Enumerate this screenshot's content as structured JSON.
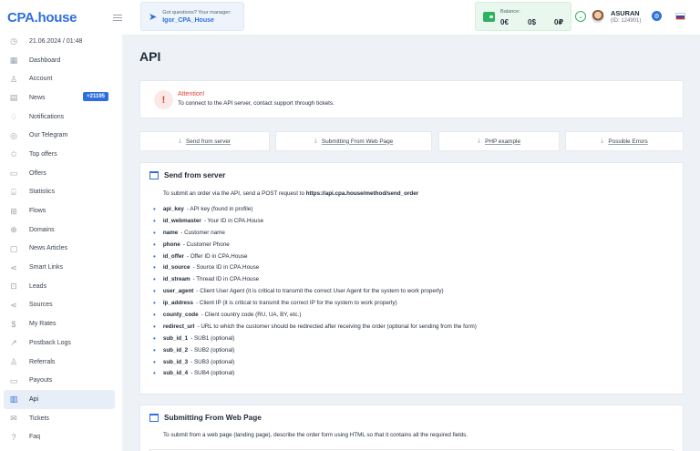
{
  "brand": {
    "logo": "CPA.house"
  },
  "sidebar": {
    "items": [
      {
        "label": "21.06.2024 / 01:48",
        "icon": "clock-icon",
        "glyph": "◷"
      },
      {
        "label": "Dashboard",
        "icon": "dashboard-icon",
        "glyph": "▦"
      },
      {
        "label": "Account",
        "icon": "user-icon",
        "glyph": "♙"
      },
      {
        "label": "News",
        "icon": "news-icon",
        "glyph": "▤",
        "badge": "+21195"
      },
      {
        "label": "Notifications",
        "icon": "bell-icon",
        "glyph": "♢"
      },
      {
        "label": "Our Telegram",
        "icon": "telegram-icon",
        "glyph": "◎"
      },
      {
        "label": "Top offers",
        "icon": "star-icon",
        "glyph": "✩"
      },
      {
        "label": "Offers",
        "icon": "offers-icon",
        "glyph": "▭"
      },
      {
        "label": "Statistics",
        "icon": "chart-icon",
        "glyph": "⌸"
      },
      {
        "label": "Flows",
        "icon": "flows-icon",
        "glyph": "⊞"
      },
      {
        "label": "Domains",
        "icon": "globe-icon",
        "glyph": "⊕"
      },
      {
        "label": "News Articles",
        "icon": "article-icon",
        "glyph": "▢"
      },
      {
        "label": "Smart Links",
        "icon": "share-icon",
        "glyph": "⋖"
      },
      {
        "label": "Leads",
        "icon": "leads-icon",
        "glyph": "⊡"
      },
      {
        "label": "Sources",
        "icon": "sources-icon",
        "glyph": "⋖"
      },
      {
        "label": "My Rates",
        "icon": "dollar-icon",
        "glyph": "$"
      },
      {
        "label": "Postback Logs",
        "icon": "postback-icon",
        "glyph": "↗"
      },
      {
        "label": "Referrals",
        "icon": "referrals-icon",
        "glyph": "♙"
      },
      {
        "label": "Payouts",
        "icon": "payouts-icon",
        "glyph": "▭"
      },
      {
        "label": "Api",
        "icon": "api-icon",
        "glyph": "▥",
        "active": true
      },
      {
        "label": "Tickets",
        "icon": "tickets-icon",
        "glyph": "✉"
      },
      {
        "label": "Faq",
        "icon": "faq-icon",
        "glyph": "?"
      }
    ]
  },
  "topbar": {
    "manager_question": "Got questions? Your manager:",
    "manager_name": "Igor_CPA_House",
    "balance_label": "Balance:",
    "balance_values": [
      "0€",
      "0$",
      "0₽"
    ],
    "user_name": "ASURAN",
    "user_id": "(ID: 124901)"
  },
  "main": {
    "title": "API",
    "attention_title": "Attention!",
    "attention_text": "To connect to the API server, contact support through tickets.",
    "tabs": [
      "Send from server",
      "Submitting From Web Page",
      "PHP example",
      "Possible Errors"
    ]
  },
  "send_from_server": {
    "title": "Send from server",
    "intro_prefix": "To submit an order via the API, send a POST request to ",
    "intro_url": "https://api.cpa.house/method/send_order",
    "params": [
      {
        "key": "api_key",
        "desc": "- API key (found in profile)"
      },
      {
        "key": "id_webmaster",
        "desc": "- Your ID in CPA.House"
      },
      {
        "key": "name",
        "desc": "- Customer name"
      },
      {
        "key": "phone",
        "desc": "- Customer Phone"
      },
      {
        "key": "id_offer",
        "desc": "- Offer ID in CPA.House"
      },
      {
        "key": "id_source",
        "desc": "- Source ID in CPA.House"
      },
      {
        "key": "id_stream",
        "desc": "- Thread ID in CPA.House"
      },
      {
        "key": "user_agent",
        "desc": "- Client User Agent (it is critical to transmit the correct User Agent for the system to work properly)"
      },
      {
        "key": "ip_address",
        "desc": "- Client IP (it is critical to transmit the correct IP for the system to work properly)"
      },
      {
        "key": "county_code",
        "desc": "- Client country code (RU, UA, BY, etc.)"
      },
      {
        "key": "redirect_url",
        "desc": "- URL to which the customer should be redirected after receiving the order (optional for sending from the form)"
      },
      {
        "key": "sub_id_1",
        "desc": "- SUB1 (optional)"
      },
      {
        "key": "sub_id_2",
        "desc": "- SUB2 (optional)"
      },
      {
        "key": "sub_id_3",
        "desc": "- SUB3 (optional)"
      },
      {
        "key": "sub_id_4",
        "desc": "- SUB4 (optional)"
      }
    ]
  },
  "web_page": {
    "title": "Submitting From Web Page",
    "intro": "To submit from a web page (landing page), describe the order form using HTML so that it contains all the required fields."
  },
  "colors": {
    "accent": "#2f6fdd",
    "danger": "#e0413a",
    "success": "#2db261"
  }
}
